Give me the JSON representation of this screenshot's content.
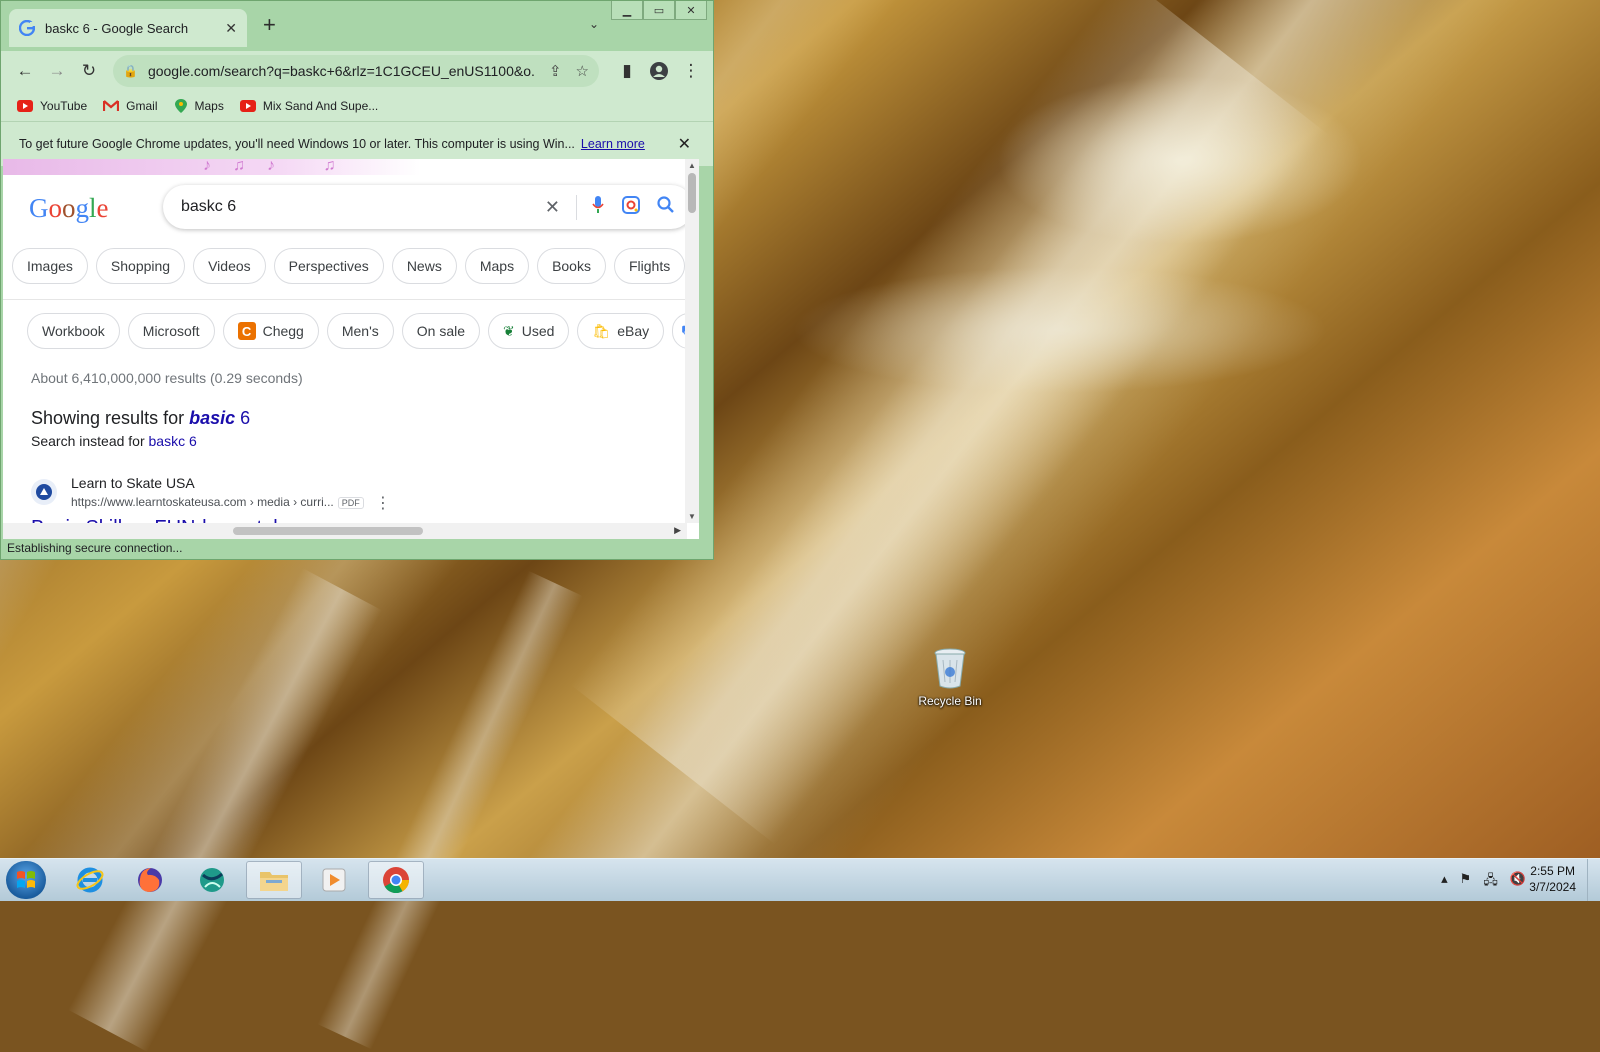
{
  "browser": {
    "tab_title": "baskc 6 - Google Search",
    "new_tab": "+",
    "url": "google.com/search?q=baskc+6&rlz=1C1GCEU_enUS1100&o...",
    "bookmarks": [
      {
        "label": "YouTube",
        "icon": "youtube-icon"
      },
      {
        "label": "Gmail",
        "icon": "gmail-icon"
      },
      {
        "label": "Maps",
        "icon": "maps-icon"
      },
      {
        "label": "Mix Sand And Supe...",
        "icon": "youtube-icon"
      }
    ],
    "infobar": {
      "message": "To get future Google Chrome updates, you'll need Windows 10 or later. This computer is using Win...",
      "link": "Learn more"
    },
    "status": "Establishing secure connection..."
  },
  "search": {
    "query": "baskc 6",
    "filters": [
      "Images",
      "Shopping",
      "Videos",
      "Perspectives",
      "News",
      "Maps",
      "Books",
      "Flights"
    ],
    "refinements": [
      "Workbook",
      "Microsoft",
      "Chegg",
      "Men's",
      "On sale",
      "Used",
      "eBay"
    ],
    "stats": "About 6,410,000,000 results (0.29 seconds)",
    "showing_prefix": "Showing results for",
    "showing_bold": "basic",
    "showing_rest": "6",
    "instead_prefix": "Search instead for",
    "instead_link": "baskc 6",
    "result": {
      "site": "Learn to Skate USA",
      "cite": "https://www.learntoskateusa.com › media › curri...",
      "pdf": "PDF",
      "title": "Basic Skills – FUNdamentals"
    }
  },
  "desktop": {
    "recycle_bin": "Recycle Bin"
  },
  "taskbar": {
    "time": "2:55 PM",
    "date": "3/7/2024"
  }
}
